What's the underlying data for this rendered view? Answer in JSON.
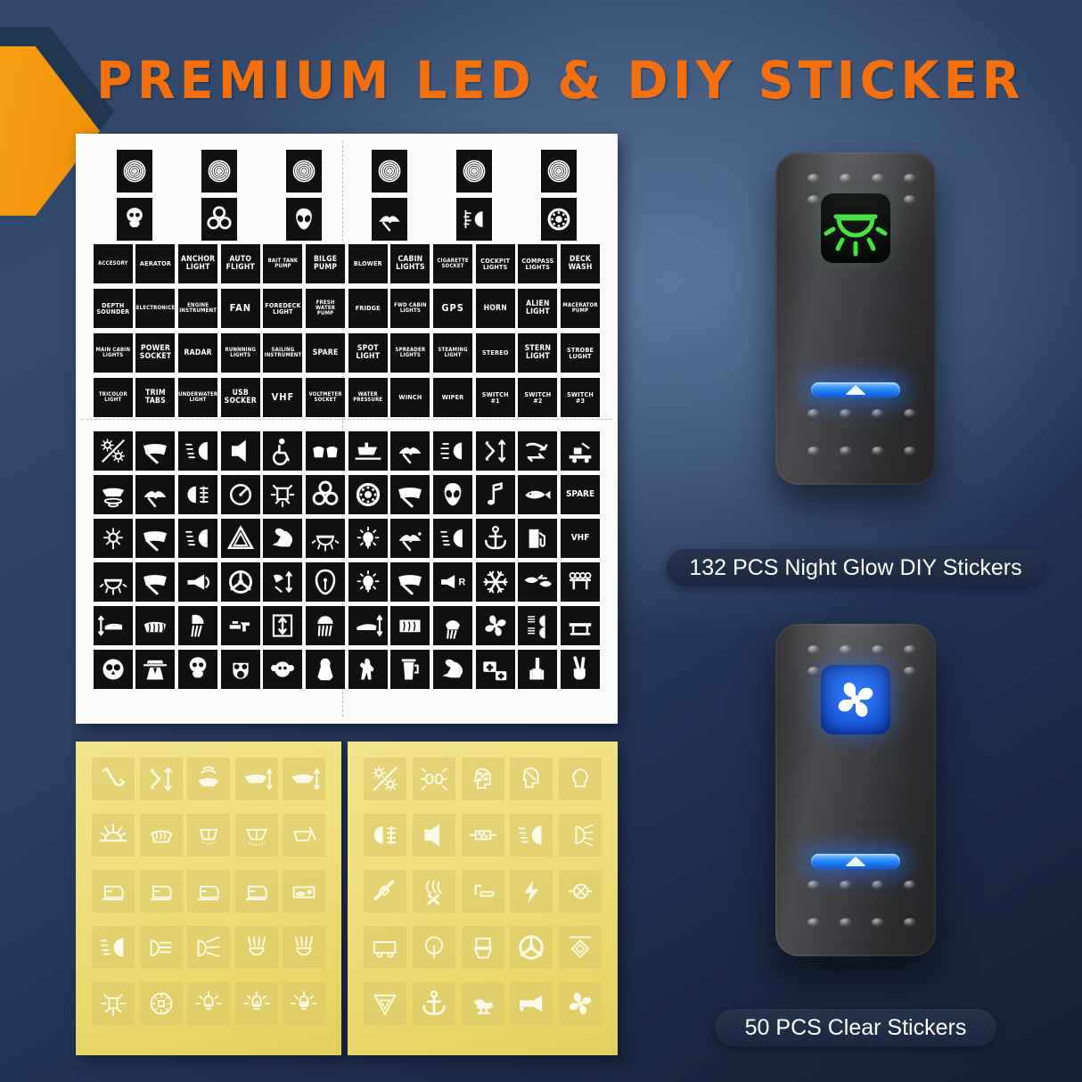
{
  "header": {
    "title": "PREMIUM LED  &  DIY STICKER",
    "accent_color": "#f4700f"
  },
  "background": {
    "top_color": "#31486a",
    "bottom_color": "#141f33",
    "highlight_color": "#6384b4"
  },
  "white_sheet": {
    "name": "132 PCS Night Glow DIY Sticker Sheet",
    "background_color": "#fbfbfb",
    "tile_color": "#101010",
    "top_icon_row_1": [
      "target-rings-icon",
      "target-rings-icon",
      "target-rings-icon",
      "target-rings-icon",
      "target-rings-icon",
      "target-rings-icon"
    ],
    "top_icon_row_2": [
      "skull-icon",
      "biohazard-icon",
      "alien-head-icon",
      "wiper-washer-icon",
      "fog-light-icon",
      "wheel-hub-icon"
    ],
    "label_rows": [
      [
        {
          "lines": [
            "ACCESORY"
          ],
          "size": "xs"
        },
        {
          "lines": [
            "AERATOR"
          ],
          "size": "s"
        },
        {
          "lines": [
            "ANCHOR",
            "LIGHT"
          ],
          "size": "m"
        },
        {
          "lines": [
            "AUTO",
            "FLIGHT"
          ],
          "size": "m"
        },
        {
          "lines": [
            "BAIT TANK",
            "PUMP"
          ],
          "size": "xs"
        },
        {
          "lines": [
            "BILGE",
            "PUMP"
          ],
          "size": "m"
        },
        {
          "lines": [
            "BLOWER"
          ],
          "size": "s"
        },
        {
          "lines": [
            "CABIN",
            "LIGHTS"
          ],
          "size": "m"
        },
        {
          "lines": [
            "CIGARETTE",
            "SOCKET"
          ],
          "size": "xs"
        },
        {
          "lines": [
            "COCKPIT",
            "LIGHTS"
          ],
          "size": "s"
        },
        {
          "lines": [
            "COMPASS",
            "LIGHTS"
          ],
          "size": "s"
        },
        {
          "lines": [
            "DECK",
            "WASH"
          ],
          "size": "m"
        }
      ],
      [
        {
          "lines": [
            "DEPTH",
            "SOUNDER"
          ],
          "size": "s"
        },
        {
          "lines": [
            "ELECTRONICE"
          ],
          "size": "xs"
        },
        {
          "lines": [
            "ENGINE",
            "INSTRUMENT"
          ],
          "size": "xs"
        },
        {
          "lines": [
            "FAN"
          ],
          "size": "l"
        },
        {
          "lines": [
            "FOREDECK",
            "LIGHT"
          ],
          "size": "s"
        },
        {
          "lines": [
            "FRESH WATER",
            "PUMP"
          ],
          "size": "xs"
        },
        {
          "lines": [
            "FRIDGE"
          ],
          "size": "s"
        },
        {
          "lines": [
            "FWD CABIN",
            "LIGHTS"
          ],
          "size": "xs"
        },
        {
          "lines": [
            "GPS"
          ],
          "size": "l"
        },
        {
          "lines": [
            "HORN"
          ],
          "size": "m"
        },
        {
          "lines": [
            "ALIEN",
            "LIGHT"
          ],
          "size": "m"
        },
        {
          "lines": [
            "MACERATOR",
            "PUMP"
          ],
          "size": "xs"
        }
      ],
      [
        {
          "lines": [
            "MAIN CABIN",
            "LIGHTS"
          ],
          "size": "xs"
        },
        {
          "lines": [
            "POWER",
            "SOCKET"
          ],
          "size": "m"
        },
        {
          "lines": [
            "RADAR"
          ],
          "size": "m"
        },
        {
          "lines": [
            "RUNNNING",
            "LIGHTS"
          ],
          "size": "xs"
        },
        {
          "lines": [
            "SAILING",
            "INSTRUMENT"
          ],
          "size": "xs"
        },
        {
          "lines": [
            "SPARE"
          ],
          "size": "m"
        },
        {
          "lines": [
            "SPOT",
            "LIGHT"
          ],
          "size": "m"
        },
        {
          "lines": [
            "SPREADER",
            "LIGHTS"
          ],
          "size": "xs"
        },
        {
          "lines": [
            "STEAMING",
            "LIGHT"
          ],
          "size": "xs"
        },
        {
          "lines": [
            "STEREO"
          ],
          "size": "s"
        },
        {
          "lines": [
            "STERN",
            "LIGHT"
          ],
          "size": "m"
        },
        {
          "lines": [
            "STROBE",
            "LUGHT"
          ],
          "size": "s"
        }
      ],
      [
        {
          "lines": [
            "TRICOLOR",
            "LIGHT"
          ],
          "size": "xs"
        },
        {
          "lines": [
            "TRIM",
            "TABS"
          ],
          "size": "m"
        },
        {
          "lines": [
            "UNDERWATER",
            "LIGHT"
          ],
          "size": "xs"
        },
        {
          "lines": [
            "USB",
            "SOCKER"
          ],
          "size": "m"
        },
        {
          "lines": [
            "VHF"
          ],
          "size": "l"
        },
        {
          "lines": [
            "VOLTMETER",
            "SOCKET"
          ],
          "size": "xs"
        },
        {
          "lines": [
            "WATER",
            "PRESSURE"
          ],
          "size": "xs"
        },
        {
          "lines": [
            "WINCH"
          ],
          "size": "s"
        },
        {
          "lines": [
            "WIPER"
          ],
          "size": "s"
        },
        {
          "lines": [
            "SWITCH",
            "#1"
          ],
          "size": "s"
        },
        {
          "lines": [
            "SWITCH",
            "#2"
          ],
          "size": "s"
        },
        {
          "lines": [
            "SWITCH",
            "#3"
          ],
          "size": "s"
        }
      ]
    ],
    "icon_rows": [
      [
        "sun-slash-icon",
        "wiper-icon",
        "headlight-beam-icon",
        "speaker-icon",
        "wheelchair-icon",
        "seat-heater-icon",
        "boat-deck-icon",
        "wiper-washer-icon",
        "fog-lamp-icon",
        "trim-updown-icon",
        "tilt-icon",
        "tow-truck-icon"
      ],
      [
        "boat-sonar-icon",
        "wiper-washer-icon",
        "high-low-beam-icon",
        "gauge-icon",
        "deck-light-icon",
        "biohazard-icon",
        "wheel-hub-icon",
        "wiper-2-icon",
        "alien-head-icon",
        "music-note-icon",
        "fish-icon",
        "SPARE"
      ],
      [
        "anchor-light-icon",
        "wiper-3-icon",
        "low-beam-icon",
        "hazard-triangle-icon",
        "rabbit-icon",
        "dome-light-icon",
        "bulb-light-icon",
        "washer-pump-icon",
        "beam-lines-icon",
        "anchor-icon",
        "fuel-pump-icon",
        "VHF"
      ],
      [
        "dome-light-rays-icon",
        "wiper-blade-icon",
        "horn-icon",
        "steering-wheel-icon",
        "trim-tab-icon",
        "pressure-gauge-icon",
        "spot-bulb-icon",
        "wiper-1-icon",
        "reverse-horn-icon",
        "snowflake-icon",
        "fish-finder-icon",
        "rail-lights-icon"
      ],
      [
        "bunk-icon",
        "defrost-icon",
        "shower-icon",
        "faucet-icon",
        "expand-arrows-icon",
        "shower-head-icon",
        "bed-tilt-icon",
        "rear-defrost-icon",
        "water-spray-icon",
        "fan-blade-icon",
        "beam-bars-icon",
        "table-icon"
      ],
      [
        "owl-icon",
        "detective-icon",
        "skull-icon",
        "gas-mask-icon",
        "monkey-icon",
        "yeti-icon",
        "bigfoot-icon",
        "beer-icon",
        "rabbit-2-icon",
        "first-aid-icon",
        "middle-finger-icon",
        "peace-hand-icon"
      ]
    ]
  },
  "yellow_sheets": [
    {
      "name": "clear-sticker-sheet-left",
      "background_color": "#efdf7d",
      "rows": [
        [
          "tilt-arrow-icon",
          "trim-updown-icon",
          "sonar-wave-icon",
          "boat-level-icon",
          "boat-trim-icon"
        ],
        [
          "sunrise-icon",
          "deck-wash-icon",
          "spreader-light-icon",
          "flood-light-icon",
          "beam-angle-icon"
        ],
        [
          "cabin-light-1-icon",
          "cabin-light-2-icon",
          "cabin-light-3-icon",
          "cabin-light-4-icon",
          "boat-fan-icon"
        ],
        [
          "low-beam-icon",
          "low-beam-2-icon",
          "spread-beam-icon",
          "dome-rays-icon",
          "dome-rays-2-icon"
        ],
        [
          "post-light-icon",
          "compass-light-icon",
          "bulb-rays-icon",
          "bulb-plus-icon",
          "bulb-bar-icon"
        ]
      ]
    },
    {
      "name": "clear-sticker-sheet-right",
      "background_color": "#efdf7d",
      "rows": [
        [
          "sun-slash-icon",
          "dual-light-icon",
          "head-fan-icon",
          "helmet-icon",
          "bulb-outline-icon"
        ],
        [
          "high-low-beam-icon",
          "speaker-icon",
          "resistor-icon",
          "beam-lines-icon",
          "beam-rays-icon"
        ],
        [
          "seatbelt-icon",
          "curl-x-icon",
          "wiper-arm-icon",
          "lightning-icon",
          "circle-x-icon"
        ],
        [
          "trailer-icon",
          "balloon-icon",
          "seat-icon",
          "steering-wheel-icon",
          "antenna-diamond-icon"
        ],
        [
          "triangle-down-icon",
          "anchor-icon",
          "recliner-icon",
          "air-horn-icon",
          "fan-blade-icon"
        ]
      ]
    }
  ],
  "switches": [
    {
      "name": "night-glow-rocker-switch",
      "icon": "cabin-dome-light-icon",
      "icon_color": "#3ee23b",
      "window_style": "black",
      "led_color": "#2b8cf7",
      "caption": "132 PCS Night Glow DIY Stickers"
    },
    {
      "name": "clear-sticker-rocker-switch",
      "icon": "fan-blade-icon",
      "icon_color": "#ffffff",
      "window_style": "blue",
      "led_color": "#2b8cf7",
      "caption": "50 PCS Clear Stickers"
    }
  ]
}
